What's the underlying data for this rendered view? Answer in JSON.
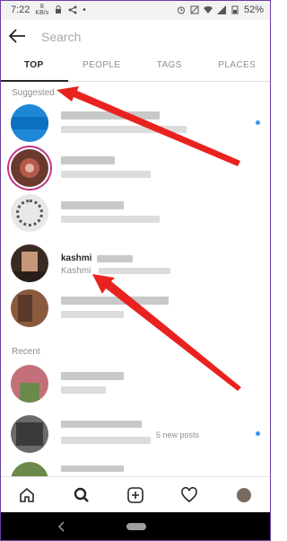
{
  "status_bar": {
    "time": "7:22",
    "speed": "8",
    "speed_unit": "KB/s",
    "battery": "52%"
  },
  "search": {
    "placeholder": "Search"
  },
  "tabs": [
    {
      "label": "TOP",
      "active": true
    },
    {
      "label": "PEOPLE",
      "active": false
    },
    {
      "label": "TAGS",
      "active": false
    },
    {
      "label": "PLACES",
      "active": false
    }
  ],
  "sections": {
    "suggested": "Suggested",
    "recent": "Recent"
  },
  "rows": {
    "kashmi_name": "kashmi",
    "kashmi_sub": "Kashmi",
    "recent_new_posts": "5 new posts"
  },
  "nav": {
    "items": [
      "home-icon",
      "search-icon",
      "add-post-icon",
      "activity-heart-icon",
      "profile-avatar"
    ]
  },
  "colors": {
    "accent_blue": "#3897f0",
    "annotation_red": "#e8231f"
  }
}
